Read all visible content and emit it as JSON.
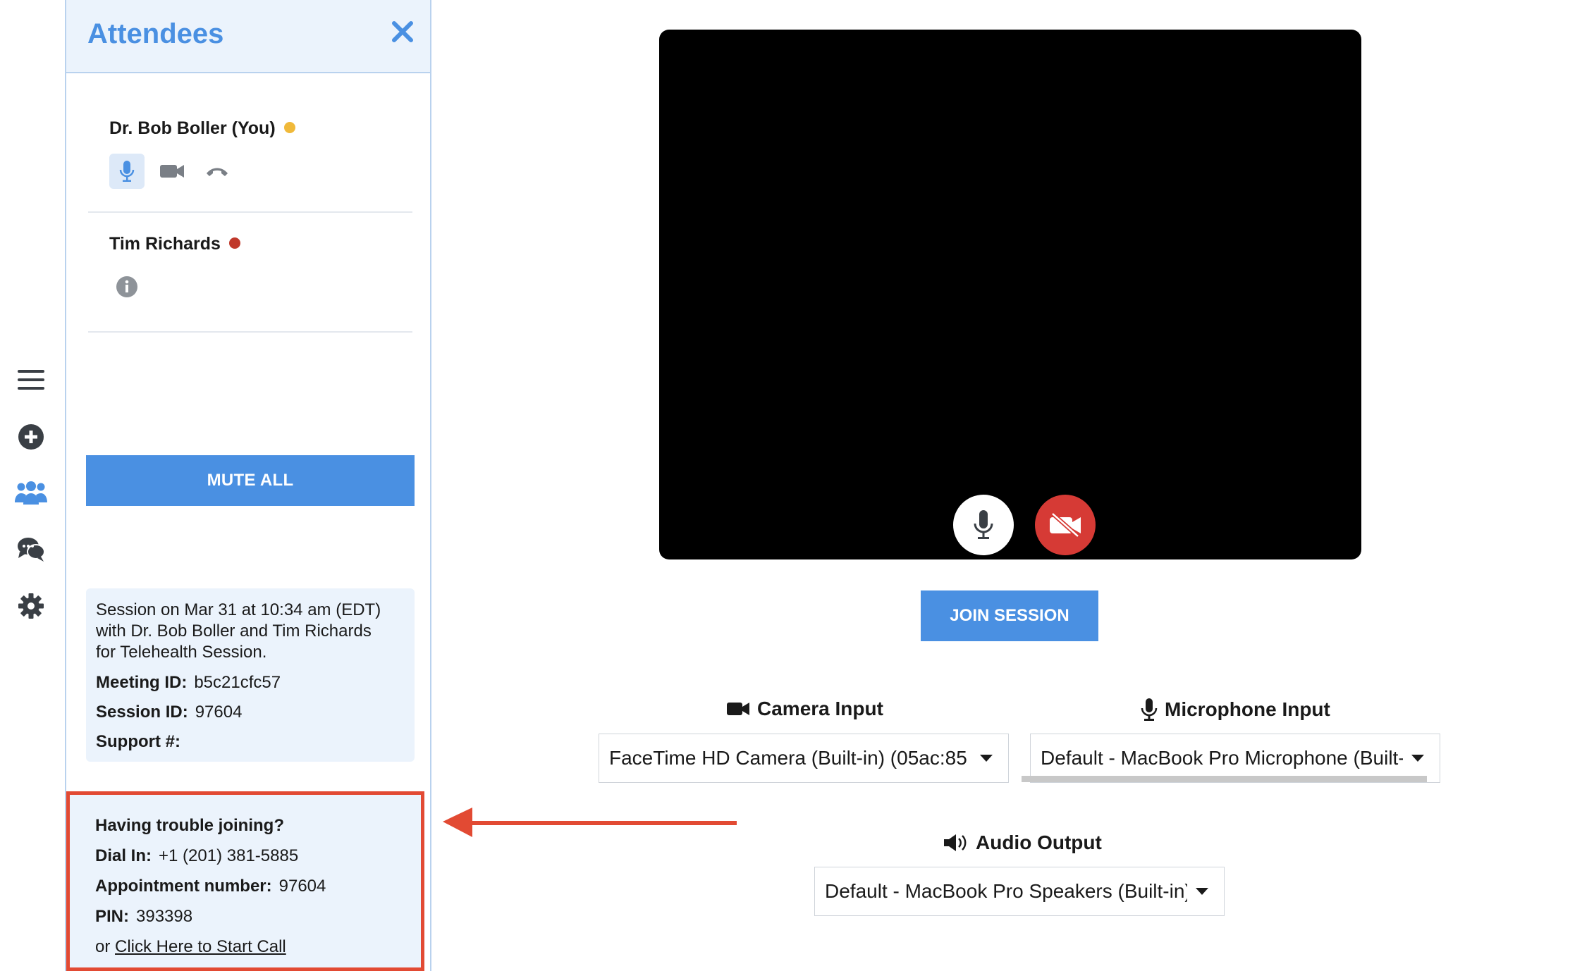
{
  "sidebar": {
    "icons": [
      "menu-icon",
      "plus-circle-icon",
      "attendees-icon",
      "chat-icon",
      "gear-icon"
    ],
    "active": "attendees-icon"
  },
  "attendees_panel": {
    "title": "Attendees",
    "attendees": [
      {
        "name": "Dr. Bob Boller (You)",
        "status_color": "#f0b93a",
        "controls": [
          "mic-icon",
          "camera-icon",
          "hang-up-icon"
        ]
      },
      {
        "name": "Tim Richards",
        "status_color": "#c0392b",
        "controls": [
          "info-icon"
        ]
      }
    ],
    "mute_all_label": "MUTE ALL"
  },
  "session_info": {
    "description_line1": "Session on Mar 31 at 10:34 am (EDT)",
    "description_line2": "with Dr. Bob Boller and Tim Richards",
    "description_line3": "for Telehealth Session.",
    "meeting_id_label": "Meeting ID:",
    "meeting_id": "b5c21cfc57",
    "session_id_label": "Session ID:",
    "session_id": "97604",
    "support_label": "Support #:",
    "support": ""
  },
  "trouble": {
    "heading": "Having trouble joining?",
    "dial_in_label": "Dial In:",
    "dial_in": "+1 (201) 381-5885",
    "appointment_label": "Appointment number:",
    "appointment": "97604",
    "pin_label": "PIN:",
    "pin": "393398",
    "or_text": "or",
    "start_call_link": "Click Here to Start Call"
  },
  "video": {
    "mic_button": "mic-icon",
    "camera_off_button": "camera-off-icon",
    "join_label": "JOIN SESSION"
  },
  "devices": {
    "camera_label": "Camera Input",
    "camera_value": "FaceTime HD Camera (Built-in) (05ac:85",
    "microphone_label": "Microphone Input",
    "microphone_value": "Default - MacBook Pro Microphone (Built-in)",
    "audio_label": "Audio Output",
    "audio_value": "Default - MacBook Pro Speakers (Built-in)"
  },
  "colors": {
    "accent": "#4a90e2",
    "panel_bg": "#ebf3fc",
    "highlight_border": "#e24a33",
    "camera_off_bg": "#d63a35"
  }
}
